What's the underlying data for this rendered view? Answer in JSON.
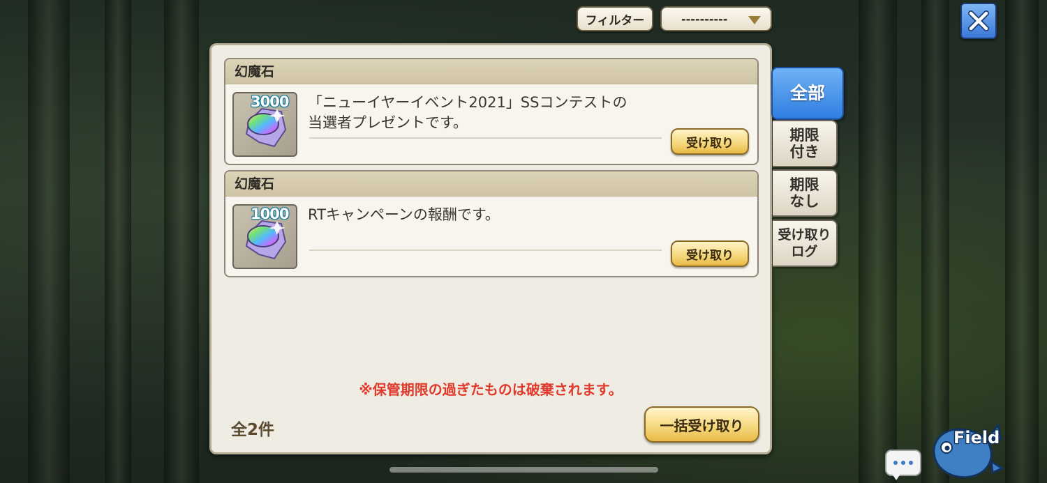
{
  "toolbar": {
    "filter_label": "フィルター",
    "filter_value": "----------"
  },
  "items": [
    {
      "category": "幻魔石",
      "quantity": "3000",
      "icon": "rainbow-crystal-icon",
      "description": "「ニューイヤーイベント2021」SSコンテストの\n当選者プレゼントです。",
      "button_label": "受け取り"
    },
    {
      "category": "幻魔石",
      "quantity": "1000",
      "icon": "rainbow-crystal-icon",
      "description": "RTキャンペーンの報酬です。",
      "button_label": "受け取り"
    }
  ],
  "notice": "※保管期限の過ぎたものは破棄されます。",
  "count_label": "全2件",
  "bulk_receive_label": "一括受け取り",
  "tabs": [
    {
      "label": "全部",
      "active": true
    },
    {
      "label": "期限\n付き",
      "active": false
    },
    {
      "label": "期限\nなし",
      "active": false
    },
    {
      "label": "受け取り\nログ",
      "active": false
    }
  ],
  "field_label": "Field",
  "colors": {
    "accent_blue": "#2f7ee0",
    "notice_red": "#e03a2c",
    "button_gold": "#f5d77a",
    "panel_bg": "#efece3"
  }
}
